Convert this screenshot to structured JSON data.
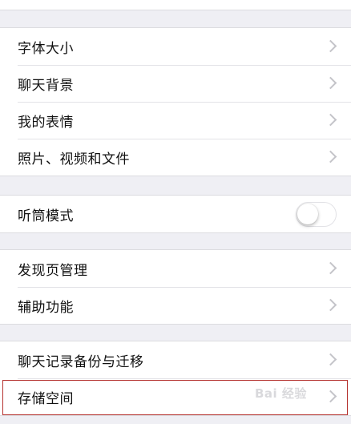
{
  "groups": [
    {
      "items": [
        {
          "label": "字体大小",
          "control": "chevron"
        },
        {
          "label": "聊天背景",
          "control": "chevron"
        },
        {
          "label": "我的表情",
          "control": "chevron"
        },
        {
          "label": "照片、视频和文件",
          "control": "chevron"
        }
      ]
    },
    {
      "items": [
        {
          "label": "听筒模式",
          "control": "toggle",
          "toggle_on": false
        }
      ]
    },
    {
      "items": [
        {
          "label": "发现页管理",
          "control": "chevron"
        },
        {
          "label": "辅助功能",
          "control": "chevron"
        }
      ]
    },
    {
      "items": [
        {
          "label": "聊天记录备份与迁移",
          "control": "chevron"
        },
        {
          "label": "存储空间",
          "control": "chevron",
          "highlighted": true
        }
      ]
    }
  ],
  "colors": {
    "background": "#efeff4",
    "highlight_border": "#b5322f"
  },
  "watermark_text": "Bai 经验"
}
